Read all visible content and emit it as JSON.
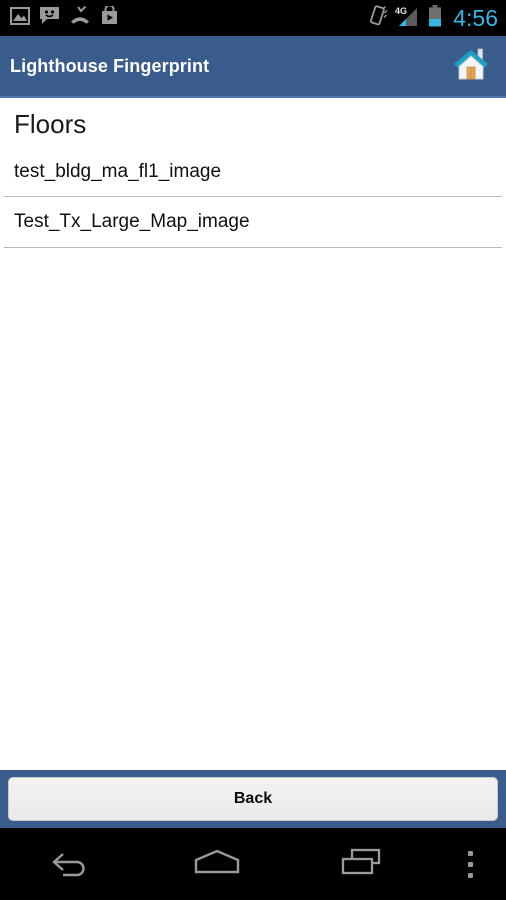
{
  "statusbar": {
    "time": "4:56",
    "left_icons": [
      {
        "name": "gallery-image-icon"
      },
      {
        "name": "sms-message-icon"
      },
      {
        "name": "missed-call-icon"
      },
      {
        "name": "play-store-icon"
      }
    ],
    "right_icons": [
      {
        "name": "vibrate-icon"
      },
      {
        "name": "signal-4g-icon",
        "label": "4G"
      },
      {
        "name": "battery-icon"
      }
    ],
    "colors": {
      "background": "#000000",
      "clock": "#33b5e5",
      "icon": "#9a9a9a"
    }
  },
  "appbar": {
    "title": "Lighthouse Fingerprint",
    "home_icon": "home-icon",
    "colors": {
      "background": "#3a5c8c",
      "border": "#4f77ad",
      "title": "#ffffff"
    }
  },
  "main": {
    "page_title": "Floors",
    "floors": [
      {
        "label": "test_bldg_ma_fl1_image"
      },
      {
        "label": "Test_Tx_Large_Map_image"
      }
    ]
  },
  "footer": {
    "back_label": "Back",
    "colors": {
      "background": "#3a5c8c",
      "button": "#efefef"
    }
  },
  "navbar": {
    "buttons": [
      {
        "name": "nav-back-icon"
      },
      {
        "name": "nav-home-icon"
      },
      {
        "name": "nav-recents-icon"
      },
      {
        "name": "nav-overflow-icon"
      }
    ],
    "colors": {
      "background": "#000000",
      "icon": "#9a9a9a"
    }
  }
}
